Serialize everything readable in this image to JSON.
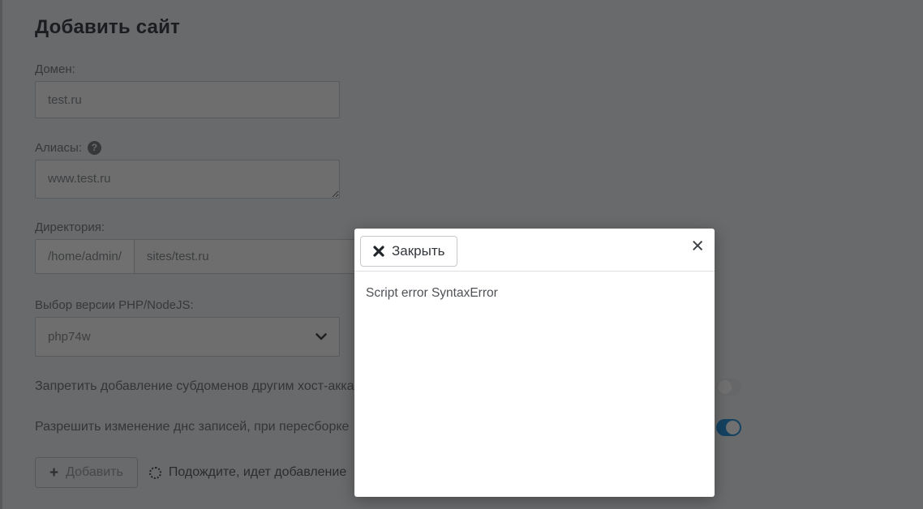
{
  "page": {
    "title": "Добавить сайт",
    "form": {
      "domain": {
        "label": "Домен:",
        "value": "test.ru"
      },
      "aliases": {
        "label": "Алиасы:",
        "help_icon": "question-circle-icon",
        "help_glyph": "?",
        "value": "www.test.ru"
      },
      "directory": {
        "label": "Директория:",
        "prefix": "/home/admin/",
        "value": "sites/test.ru"
      },
      "php_version": {
        "label": "Выбор версии PHP/NodeJS:",
        "selected": "php74w"
      }
    },
    "toggles": [
      {
        "label": "Запретить добавление субдоменов другим хост-акка",
        "state": "off"
      },
      {
        "label": "Разрешить изменение днс записей, при пересборке",
        "state": "on"
      }
    ],
    "submit": {
      "plus_glyph": "+",
      "button_label": "Добавить",
      "disabled": true,
      "status_text": "Подождите, идет добавление"
    }
  },
  "modal": {
    "close_button_label": "Закрыть",
    "close_icon_glyph": "×",
    "body_text": "Script error SyntaxError"
  },
  "colors": {
    "page_background": "#F0F1F3",
    "backdrop": "rgba(0,0,0,0.56)",
    "toggle_on": "#2F96DC",
    "modal_background": "#FFFFFF",
    "input_border": "#C9CCCF"
  }
}
